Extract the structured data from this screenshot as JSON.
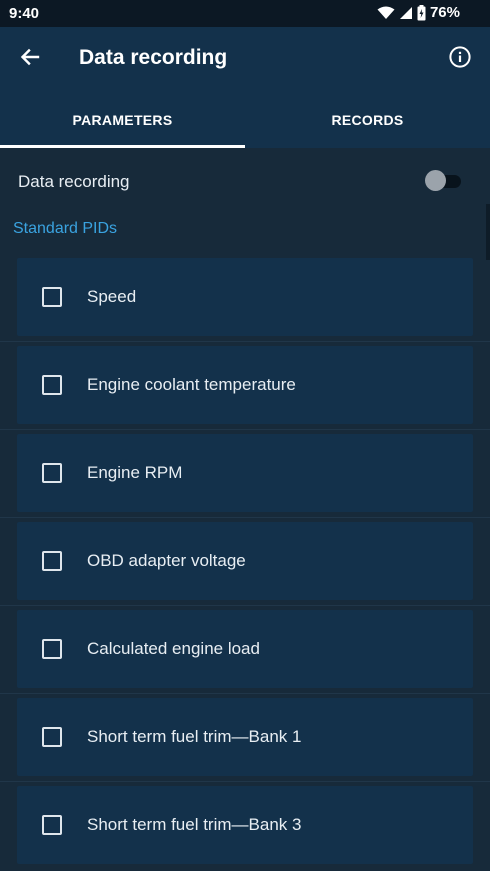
{
  "status_bar": {
    "time": "9:40",
    "battery_percent": "76%",
    "icons": [
      "wifi-icon",
      "cellular-signal-icon",
      "battery-icon"
    ]
  },
  "app_bar": {
    "title": "Data recording",
    "back_icon": "arrow-back-icon",
    "info_icon": "info-icon"
  },
  "tabs": [
    {
      "label": "PARAMETERS",
      "active": true
    },
    {
      "label": "RECORDS",
      "active": false
    }
  ],
  "data_recording": {
    "label": "Data recording",
    "enabled": false
  },
  "section": {
    "title": "Standard PIDs"
  },
  "pids": [
    {
      "label": "Speed",
      "checked": false
    },
    {
      "label": "Engine coolant temperature",
      "checked": false
    },
    {
      "label": "Engine RPM",
      "checked": false
    },
    {
      "label": "OBD adapter voltage",
      "checked": false
    },
    {
      "label": "Calculated engine load",
      "checked": false
    },
    {
      "label": "Short term fuel trim—Bank 1",
      "checked": false
    },
    {
      "label": "Short term fuel trim—Bank 3",
      "checked": false
    }
  ],
  "colors": {
    "app_bar": "#13314b",
    "background": "#172a3a",
    "accent": "#3aa3e0",
    "status_bar": "#0c1824"
  }
}
